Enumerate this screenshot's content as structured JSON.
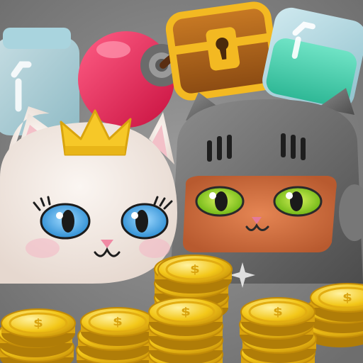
{
  "scene": {
    "background_color": "#8b8b8b",
    "items": [
      {
        "name": "empty-jar",
        "icon": "empty-jar-icon"
      },
      {
        "name": "bomb",
        "icon": "bomb-icon"
      },
      {
        "name": "treasure-chest",
        "icon": "treasure-chest-icon"
      },
      {
        "name": "potion-jar",
        "icon": "potion-jar-icon"
      }
    ],
    "characters": [
      {
        "name": "princess-cat",
        "accessory": "crown-icon",
        "fur_color": "#f4ece6",
        "eye_color": "#4aa6e8"
      },
      {
        "name": "knight-cat",
        "accessory": "helmet-icon",
        "fur_color": "#d06a3c",
        "eye_color": "#8bd220"
      }
    ],
    "coin_symbol": "$",
    "coin_color": "#f1c21a"
  }
}
